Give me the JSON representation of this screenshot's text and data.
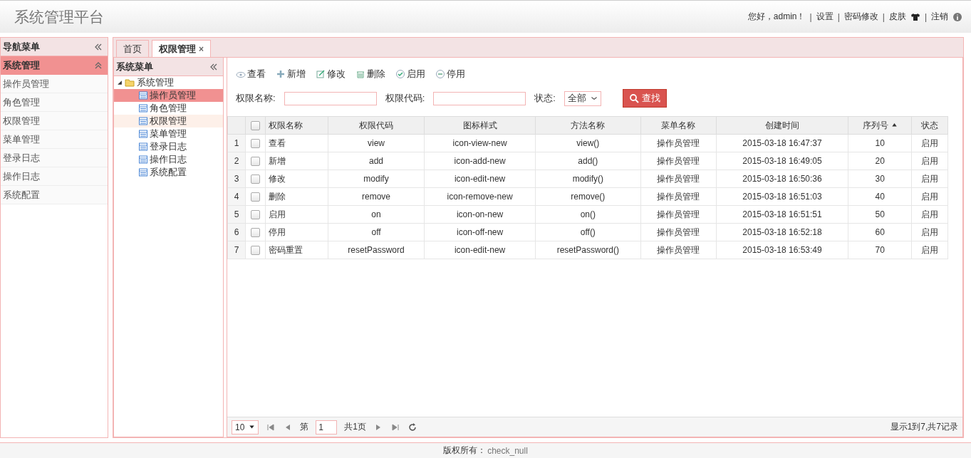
{
  "header": {
    "title": "系统管理平台",
    "links": [
      {
        "kind": "text",
        "label": "您好，admin！"
      },
      {
        "kind": "link",
        "sep": "|",
        "label": "设置"
      },
      {
        "kind": "link",
        "sep": "|",
        "label": "密码修改"
      },
      {
        "kind": "skin",
        "sep": "|",
        "label": "皮肤"
      },
      {
        "kind": "info",
        "sep": "|",
        "label": "注销"
      }
    ]
  },
  "nav": {
    "title": "导航菜单",
    "group": "系统管理",
    "items": [
      {
        "label": "操作员管理",
        "selected": false
      },
      {
        "label": "角色管理",
        "selected": false
      },
      {
        "label": "权限管理",
        "selected": false
      },
      {
        "label": "菜单管理",
        "selected": false
      },
      {
        "label": "登录日志",
        "selected": false
      },
      {
        "label": "操作日志",
        "selected": false
      },
      {
        "label": "系统配置",
        "selected": false
      }
    ]
  },
  "tabs": [
    {
      "label": "首页",
      "selected": false
    },
    {
      "label": "权限管理",
      "selected": true,
      "close": "×"
    }
  ],
  "tree": {
    "title": "系统菜单",
    "root": {
      "label": "系统管理",
      "expanded": true,
      "children": [
        {
          "label": "操作员管理",
          "selected": true,
          "hover": false
        },
        {
          "label": "角色管理",
          "selected": false,
          "hover": false
        },
        {
          "label": "权限管理",
          "selected": false,
          "hover": true
        },
        {
          "label": "菜单管理",
          "selected": false,
          "hover": false
        },
        {
          "label": "登录日志",
          "selected": false,
          "hover": false
        },
        {
          "label": "操作日志",
          "selected": false,
          "hover": false
        },
        {
          "label": "系统配置",
          "selected": false,
          "hover": false
        }
      ]
    }
  },
  "toolbar": [
    {
      "kind": "view",
      "label": "查看"
    },
    {
      "kind": "add",
      "label": "新增"
    },
    {
      "kind": "edit",
      "label": "修改"
    },
    {
      "kind": "remove",
      "label": "删除"
    },
    {
      "kind": "on",
      "label": "启用"
    },
    {
      "kind": "off",
      "label": "停用"
    }
  ],
  "search": {
    "name_label": "权限名称:",
    "code_label": "权限代码:",
    "status_label": "状态:",
    "status_value": "全部",
    "button": "查找"
  },
  "table": {
    "all_checked": false,
    "columns": [
      {
        "label": "权限名称",
        "sorted": false
      },
      {
        "label": "权限代码",
        "sorted": false
      },
      {
        "label": "图标样式",
        "sorted": false
      },
      {
        "label": "方法名称",
        "sorted": false
      },
      {
        "label": "菜单名称",
        "sorted": false
      },
      {
        "label": "创建时间",
        "sorted": false
      },
      {
        "label": "序列号",
        "sorted": true
      },
      {
        "label": "状态",
        "sorted": false
      }
    ],
    "rows": [
      {
        "num": "1",
        "checked": false,
        "cells": [
          "查看",
          "view",
          "icon-view-new",
          "view()",
          "操作员管理",
          "2015-03-18 16:47:37",
          "10",
          "启用"
        ]
      },
      {
        "num": "2",
        "checked": false,
        "cells": [
          "新增",
          "add",
          "icon-add-new",
          "add()",
          "操作员管理",
          "2015-03-18 16:49:05",
          "20",
          "启用"
        ]
      },
      {
        "num": "3",
        "checked": false,
        "cells": [
          "修改",
          "modify",
          "icon-edit-new",
          "modify()",
          "操作员管理",
          "2015-03-18 16:50:36",
          "30",
          "启用"
        ]
      },
      {
        "num": "4",
        "checked": false,
        "cells": [
          "删除",
          "remove",
          "icon-remove-new",
          "remove()",
          "操作员管理",
          "2015-03-18 16:51:03",
          "40",
          "启用"
        ]
      },
      {
        "num": "5",
        "checked": false,
        "cells": [
          "启用",
          "on",
          "icon-on-new",
          "on()",
          "操作员管理",
          "2015-03-18 16:51:51",
          "50",
          "启用"
        ]
      },
      {
        "num": "6",
        "checked": false,
        "cells": [
          "停用",
          "off",
          "icon-off-new",
          "off()",
          "操作员管理",
          "2015-03-18 16:52:18",
          "60",
          "启用"
        ]
      },
      {
        "num": "7",
        "checked": false,
        "cells": [
          "密码重置",
          "resetPassword",
          "icon-edit-new",
          "resetPassword()",
          "操作员管理",
          "2015-03-18 16:53:49",
          "70",
          "启用"
        ]
      }
    ]
  },
  "pager": {
    "page_size": "10",
    "page_prefix": "第",
    "page": "1",
    "page_suffix": "共1页",
    "summary": "显示1到7,共7记录"
  },
  "footer": {
    "label": "版权所有：",
    "value": "check_null"
  }
}
